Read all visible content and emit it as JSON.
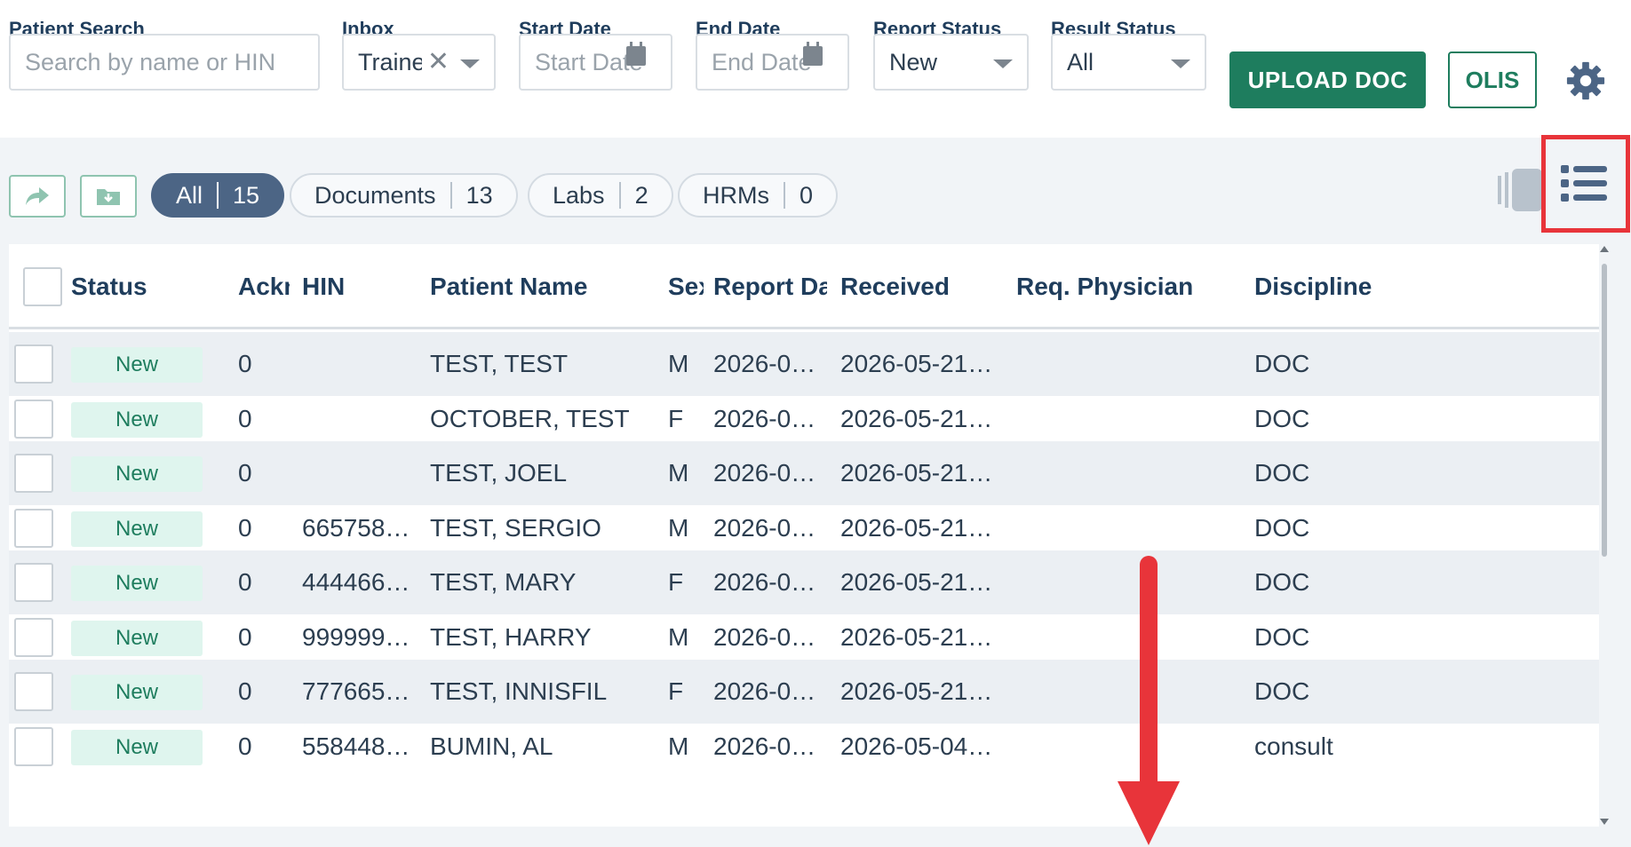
{
  "filters": {
    "patient_search": {
      "label": "Patient Search",
      "placeholder": "Search by name or HIN"
    },
    "inbox": {
      "label": "Inbox",
      "value": "Trainer"
    },
    "start_date": {
      "label": "Start Date",
      "placeholder": "Start Date"
    },
    "end_date": {
      "label": "End Date",
      "placeholder": "End Date"
    },
    "report_status": {
      "label": "Report Status",
      "value": "New"
    },
    "result_status": {
      "label": "Result Status",
      "value": "All"
    },
    "upload_label": "UPLOAD DOC",
    "olis_label": "OLIS"
  },
  "tabs": [
    {
      "label": "All",
      "count": "15"
    },
    {
      "label": "Documents",
      "count": "13"
    },
    {
      "label": "Labs",
      "count": "2"
    },
    {
      "label": "HRMs",
      "count": "0"
    }
  ],
  "columns": {
    "status": "Status",
    "ack": "Acknowledged",
    "hin": "HIN",
    "patient_name": "Patient Name",
    "sex": "Sex",
    "report_date": "Report Date",
    "received": "Received",
    "req_physician": "Req. Physician",
    "discipline": "Discipline"
  },
  "rows": [
    {
      "status": "New",
      "ack": "0",
      "hin": "",
      "name": "TEST, TEST",
      "sex": "M",
      "report_date": "2026-0…",
      "received": "2026-05-21…",
      "physician": "",
      "discipline": "DOC"
    },
    {
      "status": "New",
      "ack": "0",
      "hin": "",
      "name": "OCTOBER, TEST",
      "sex": "F",
      "report_date": "2026-0…",
      "received": "2026-05-21…",
      "physician": "",
      "discipline": "DOC"
    },
    {
      "status": "New",
      "ack": "0",
      "hin": "",
      "name": "TEST, JOEL",
      "sex": "M",
      "report_date": "2026-0…",
      "received": "2026-05-21…",
      "physician": "",
      "discipline": "DOC"
    },
    {
      "status": "New",
      "ack": "0",
      "hin": "665758…",
      "name": "TEST, SERGIO",
      "sex": "M",
      "report_date": "2026-0…",
      "received": "2026-05-21…",
      "physician": "",
      "discipline": "DOC"
    },
    {
      "status": "New",
      "ack": "0",
      "hin": "444466…",
      "name": "TEST, MARY",
      "sex": "F",
      "report_date": "2026-0…",
      "received": "2026-05-21…",
      "physician": "",
      "discipline": "DOC"
    },
    {
      "status": "New",
      "ack": "0",
      "hin": "999999…",
      "name": "TEST, HARRY",
      "sex": "M",
      "report_date": "2026-0…",
      "received": "2026-05-21…",
      "physician": "",
      "discipline": "DOC"
    },
    {
      "status": "New",
      "ack": "0",
      "hin": "777665…",
      "name": "TEST, INNISFIL",
      "sex": "F",
      "report_date": "2026-0…",
      "received": "2026-05-21…",
      "physician": "",
      "discipline": "DOC"
    },
    {
      "status": "New",
      "ack": "0",
      "hin": "558448…",
      "name": "BUMIN, AL",
      "sex": "M",
      "report_date": "2026-0…",
      "received": "2026-05-04…",
      "physician": "",
      "discipline": "consult"
    }
  ],
  "colors": {
    "primary_green": "#1e7d5e",
    "status_badge_bg": "#dff5ee",
    "active_tab": "#4c6585",
    "annotation_red": "#e8343a"
  },
  "icons": {
    "forward": "share-forward-icon",
    "download": "folder-download-icon",
    "settings": "gear-icon",
    "split_view": "split-view-icon",
    "list_view": "list-view-icon",
    "calendar": "calendar-icon"
  }
}
